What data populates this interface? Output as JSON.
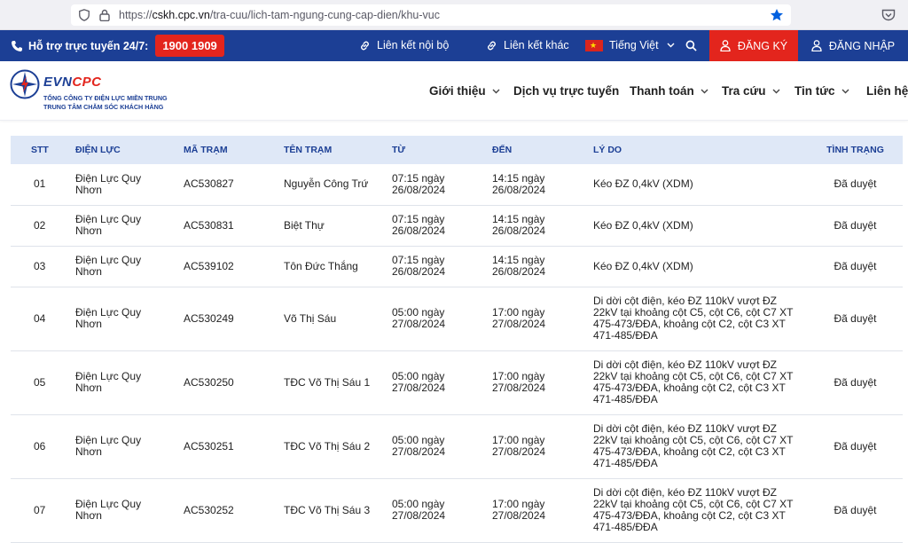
{
  "browser": {
    "url_prefix": "https://",
    "url_host": "cskh.cpc.vn",
    "url_path": "/tra-cuu/lich-tam-ngung-cung-cap-dien/khu-vuc"
  },
  "topbar": {
    "hotline_label": "Hỗ trợ trực tuyến 24/7:",
    "hotline_number": "1900 1909",
    "internal_link": "Liên kết nội bộ",
    "other_link": "Liên kết khác",
    "language": "Tiếng Việt",
    "register": "ĐĂNG KÝ",
    "login": "ĐĂNG NHẬP"
  },
  "logo": {
    "evn": "EVN",
    "cpc": "CPC",
    "line1": "TỔNG CÔNG TY ĐIỆN LỰC MIỀN TRUNG",
    "line2": "TRUNG TÂM CHĂM SÓC KHÁCH HÀNG"
  },
  "nav": {
    "items": [
      "Giới thiệu",
      "Dịch vụ trực tuyến",
      "Thanh toán",
      "Tra cứu",
      "Tin tức",
      "Liên hệ"
    ]
  },
  "table": {
    "headers": [
      "STT",
      "ĐIỆN LỰC",
      "MÃ TRẠM",
      "TÊN TRẠM",
      "TỪ",
      "ĐẾN",
      "LÝ DO",
      "TÌNH TRẠNG"
    ],
    "rows": [
      {
        "stt": "01",
        "dien_luc": "Điện Lực Quy Nhơn",
        "ma_tram": "AC530827",
        "ten_tram": "Nguyễn Công Trứ",
        "tu": "07:15 ngày 26/08/2024",
        "den": "14:15 ngày 26/08/2024",
        "ly_do": "Kéo ĐZ 0,4kV (XDM)",
        "tinh_trang": "Đã duyệt"
      },
      {
        "stt": "02",
        "dien_luc": "Điện Lực Quy Nhơn",
        "ma_tram": "AC530831",
        "ten_tram": "Biệt Thự",
        "tu": "07:15 ngày 26/08/2024",
        "den": "14:15 ngày 26/08/2024",
        "ly_do": "Kéo ĐZ 0,4kV (XDM)",
        "tinh_trang": "Đã duyệt"
      },
      {
        "stt": "03",
        "dien_luc": "Điện Lực Quy Nhơn",
        "ma_tram": "AC539102",
        "ten_tram": "Tôn Đức Thắng",
        "tu": "07:15 ngày 26/08/2024",
        "den": "14:15 ngày 26/08/2024",
        "ly_do": "Kéo ĐZ 0,4kV (XDM)",
        "tinh_trang": "Đã duyệt"
      },
      {
        "stt": "04",
        "dien_luc": "Điện Lực Quy Nhơn",
        "ma_tram": "AC530249",
        "ten_tram": "Võ Thị Sáu",
        "tu": "05:00 ngày 27/08/2024",
        "den": "17:00 ngày 27/08/2024",
        "ly_do": "Di dời cột điện, kéo ĐZ 110kV vượt ĐZ 22kV tại khoảng cột C5, cột C6, cột C7 XT 475-473/ĐĐA, khoảng cột C2, cột C3 XT 471-485/ĐĐA",
        "tinh_trang": "Đã duyệt"
      },
      {
        "stt": "05",
        "dien_luc": "Điện Lực Quy Nhơn",
        "ma_tram": "AC530250",
        "ten_tram": "TĐC Võ Thị Sáu 1",
        "tu": "05:00 ngày 27/08/2024",
        "den": "17:00 ngày 27/08/2024",
        "ly_do": "Di dời cột điện, kéo ĐZ 110kV vượt ĐZ 22kV tại khoảng cột C5, cột C6, cột C7 XT 475-473/ĐĐA, khoảng cột C2, cột C3 XT 471-485/ĐĐA",
        "tinh_trang": "Đã duyệt"
      },
      {
        "stt": "06",
        "dien_luc": "Điện Lực Quy Nhơn",
        "ma_tram": "AC530251",
        "ten_tram": "TĐC Võ Thị Sáu 2",
        "tu": "05:00 ngày 27/08/2024",
        "den": "17:00 ngày 27/08/2024",
        "ly_do": "Di dời cột điện, kéo ĐZ 110kV vượt ĐZ 22kV tại khoảng cột C5, cột C6, cột C7 XT 475-473/ĐĐA, khoảng cột C2, cột C3 XT 471-485/ĐĐA",
        "tinh_trang": "Đã duyệt"
      },
      {
        "stt": "07",
        "dien_luc": "Điện Lực Quy Nhơn",
        "ma_tram": "AC530252",
        "ten_tram": "TĐC Võ Thị Sáu 3",
        "tu": "05:00 ngày 27/08/2024",
        "den": "17:00 ngày 27/08/2024",
        "ly_do": "Di dời cột điện, kéo ĐZ 110kV vượt ĐZ 22kV tại khoảng cột C5, cột C6, cột C7 XT 475-473/ĐĐA, khoảng cột C2, cột C3 XT 471-485/ĐĐA",
        "tinh_trang": "Đã duyệt"
      }
    ]
  },
  "colors": {
    "brand_blue": "#1c3f95",
    "brand_red": "#e3251d",
    "table_header_bg": "#dfe8f7"
  }
}
